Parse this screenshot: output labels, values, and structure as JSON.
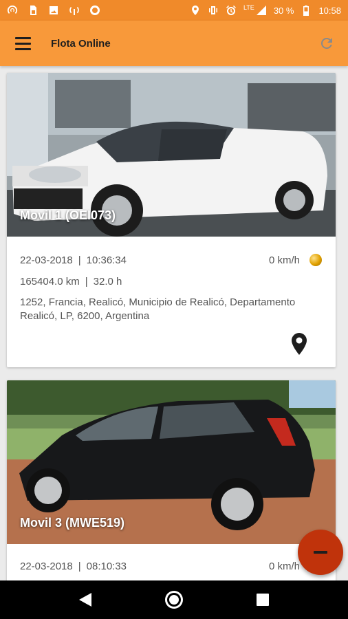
{
  "status_bar": {
    "battery": "30 %",
    "time": "10:58",
    "network": "LTE",
    "icons_left": [
      "signal-tower-icon",
      "sim-icon",
      "image-icon",
      "wifi-calling-icon",
      "circle-icon"
    ],
    "icons_right": [
      "location-icon",
      "vibrate-icon",
      "alarm-icon",
      "lte-signal-icon",
      "battery-icon"
    ]
  },
  "app_bar": {
    "title": "Flota Online",
    "menu_icon": "hamburger-menu-icon",
    "refresh_icon": "refresh-icon"
  },
  "vehicles": [
    {
      "name": "Movil 1 (OEI073)",
      "date": "22-03-2018",
      "time": "10:36:34",
      "speed": "0 km/h",
      "odometer": "165404.0 km",
      "hours": "32.0 h",
      "address": "1252, Francia, Realicó, Municipio de Realicó, Departamento Realicó, LP, 6200, Argentina",
      "status_color": "#e0a000"
    },
    {
      "name": "Movil 3 (MWE519)",
      "date": "22-03-2018",
      "time": "08:10:33",
      "speed": "0 km/h",
      "status_color": "#e0a000"
    }
  ],
  "separator": "|",
  "fab": {
    "icon": "minus-icon",
    "color": "#c0330b"
  },
  "colors": {
    "status_bar": "#f08a2a",
    "app_bar": "#f8993a"
  }
}
